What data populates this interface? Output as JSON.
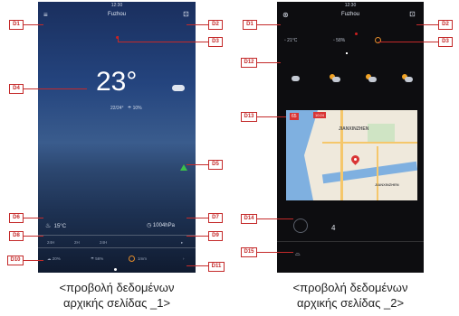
{
  "screen1": {
    "status_time": "12:30",
    "city": "Fuzhou",
    "temperature": "23°",
    "temp_range": "22/24°",
    "humidity": "10%",
    "indoor_temp": "15°C",
    "pressure": "1004hPa",
    "forecast_tabs": [
      "24H",
      "2H",
      "24H"
    ],
    "footer_values": [
      "20%",
      "56%",
      "1mm"
    ],
    "caption_line1": "<προβολή δεδομένων",
    "caption_line2": "αρχικής σελίδας _1>"
  },
  "screen2": {
    "status_time": "12:30",
    "city": "Fuzhou",
    "top_temp": "21°C",
    "top_humidity": "58%",
    "map_label": "JIANXINZHEN",
    "map_tag": "65",
    "map_tag2": "10:24",
    "map_label2": "JIANXINZHEN",
    "wind_value": "4",
    "caption_line1": "<προβολή δεδομένων",
    "caption_line2": "αρχικής σελίδας _2>"
  },
  "labels": {
    "d1": "D1",
    "d2": "D2",
    "d3": "D3",
    "d4": "D4",
    "d5": "D5",
    "d6": "D6",
    "d7": "D7",
    "d8": "D8",
    "d9": "D9",
    "d10": "D10",
    "d11": "D11",
    "d12": "D12",
    "d13": "D13",
    "d14": "D14",
    "d15": "D15"
  },
  "colors": {
    "annotation_red": "#c42a2a",
    "warning_green": "#3bbf4a",
    "accent_orange": "#e28b2b",
    "dark_bg": "#0d0d10"
  }
}
